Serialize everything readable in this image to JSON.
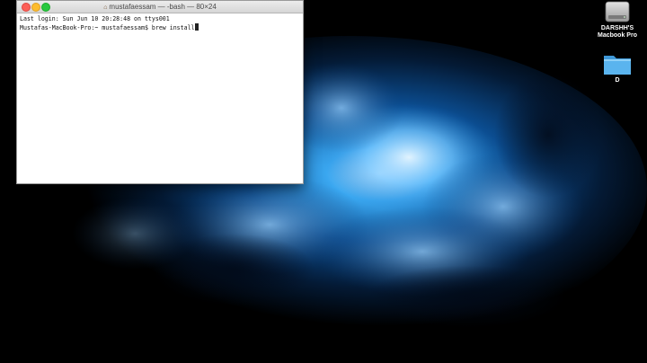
{
  "terminal": {
    "title": "mustafaessam — -bash — 80×24",
    "lines": [
      "Last login: Sun Jun 10 20:28:48 on ttys001",
      "Mustafas-MacBook-Pro:~ mustafaessam$ brew install"
    ]
  },
  "desktop": {
    "drive_label_line1": "DARSHH'S",
    "drive_label_line2": "Macbook Pro",
    "folder_label": "D"
  },
  "colors": {
    "close": "#fc5f57",
    "minimize": "#fdbc2e",
    "zoom": "#28c840",
    "folder": "#5ab4ee"
  }
}
